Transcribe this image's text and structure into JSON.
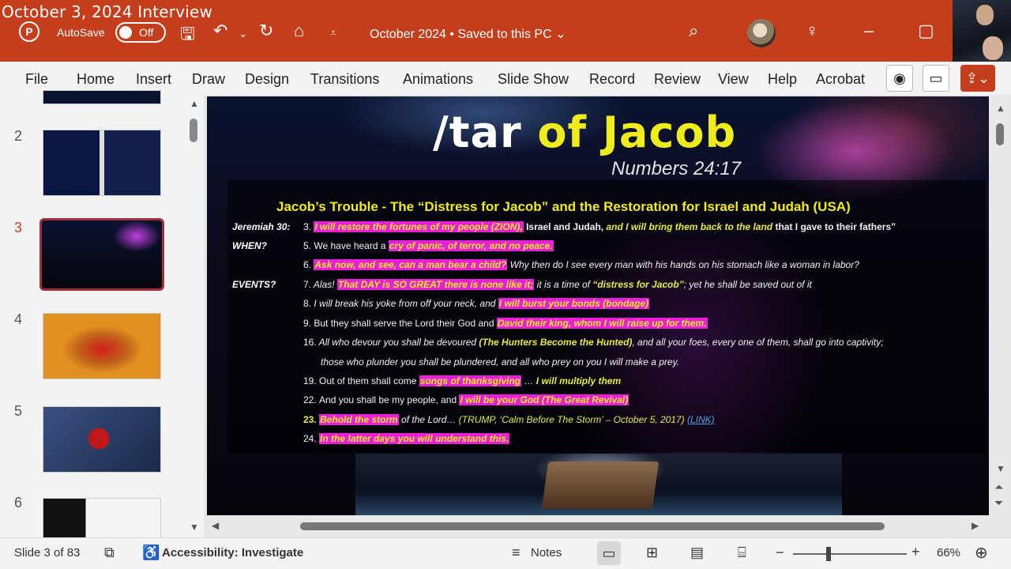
{
  "overlay_title": "October 3, 2024 Interview",
  "titlebar": {
    "app_icon": "powerpoint-icon",
    "autosave_label": "AutoSave",
    "autosave_state": "Off",
    "document_title": "October 2024 • Saved to this PC ⌄",
    "accent_color": "#c43e1c"
  },
  "ribbon": {
    "tabs": [
      "File",
      "Home",
      "Insert",
      "Draw",
      "Design",
      "Transitions",
      "Animations",
      "Slide Show",
      "Record",
      "Review",
      "View",
      "Help",
      "Acrobat"
    ]
  },
  "thumbnails": [
    {
      "number": "2"
    },
    {
      "number": "3",
      "active": true
    },
    {
      "number": "4"
    },
    {
      "number": "5"
    },
    {
      "number": "6"
    }
  ],
  "slide": {
    "title_part1": "/tar",
    "title_part2": "of Jacob",
    "subtitle": "Numbers 24:17",
    "heading": "Jacob’s Trouble - The “Distress for Jacob”  and the Restoration for Israel and Judah (USA)",
    "labels": {
      "jeremiah": "Jeremiah 30:",
      "when": "WHEN?",
      "events": "EVENTS?"
    },
    "lines": {
      "l3": {
        "num": "3.",
        "hl": "I will restore the fortunes of my people (ZION),",
        "t1": " Israel and Judah, ",
        "g1": "and I will bring them back to the land",
        "t2": " that I gave to their fathers”"
      },
      "l5": {
        "num": "5.",
        "t1": "We have heard a ",
        "hl": "cry of panic, of terror, and no peace."
      },
      "l6": {
        "num": "6.",
        "hl": "Ask now, and see, can a man bear a child?",
        "t1": " Why then do I see every man with his hands on his stomach like a woman in labor?"
      },
      "l7": {
        "num": "7.",
        "t1": "Alas! ",
        "hl": "That DAY is SO GREAT there is none like it;",
        "t2": " it is a time of ",
        "g1": "“distress for Jacob”",
        "t3": "; yet he shall be saved out of it"
      },
      "l8": {
        "num": "8.",
        "t1": "I will break his yoke from off your neck, and ",
        "hl": "I will burst your bonds (bondage)"
      },
      "l9": {
        "num": "9.",
        "t1": "But they shall serve the Lord their God and ",
        "hl": "David their king, whom I will raise up for them."
      },
      "l16": {
        "num": "16.",
        "t1": "All who devour you shall be devoured ",
        "g1": "(The Hunters Become the Hunted)",
        "t2": ", and all your foes, every one of them, shall go into captivity;"
      },
      "l16b": {
        "t1": "those who plunder you shall be plundered, and all who prey on you I will make a prey."
      },
      "l19": {
        "num": "19.",
        "t1": "Out of them shall come ",
        "hl": "songs of thanksgiving",
        "t2": " … ",
        "g1": "I will multiply them"
      },
      "l22": {
        "num": "22.",
        "t1": "And you shall be my people, and ",
        "hl": "I will be your God (The Great Revival)"
      },
      "l23": {
        "num": "23.",
        "hl": "Behold the storm",
        "t1": " of the Lord… ",
        "g1": "(TRUMP, ‘Calm Before The Storm’ – October 5, 2017)",
        "link": "(LINK)"
      },
      "l24": {
        "num": "24.",
        "hl": " In the latter days you will understand this."
      }
    }
  },
  "statusbar": {
    "slide_info": "Slide 3 of 83",
    "accessibility": "Accessibility: Investigate",
    "notes": "Notes",
    "zoom_minus": "−",
    "zoom_plus": "+",
    "zoom_level": "66%"
  }
}
